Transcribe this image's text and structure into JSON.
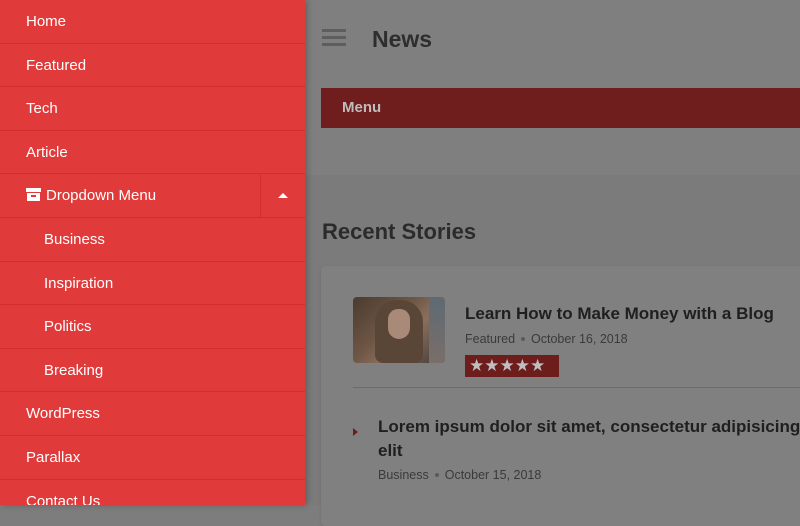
{
  "header": {
    "site_title": "News",
    "menu_label": "Menu",
    "hamburger_icon": "hamburger-menu-icon"
  },
  "content": {
    "section_title": "Recent Stories",
    "stories": [
      {
        "title": "Learn How to Make Money with a Blog",
        "category": "Featured",
        "date": "October 16, 2018",
        "rating_stars": "★★★★★",
        "rating": 5
      },
      {
        "title": "Lorem ipsum dolor sit amet, consectetur adipisicing elit",
        "category": "Business",
        "date": "October 15, 2018"
      }
    ]
  },
  "drawer": {
    "items": [
      {
        "label": "Home"
      },
      {
        "label": "Featured"
      },
      {
        "label": "Tech"
      },
      {
        "label": "Article"
      },
      {
        "label": "Dropdown Menu",
        "icon": "archive-box-icon",
        "expanded": true
      },
      {
        "label": "Business"
      },
      {
        "label": "Inspiration"
      },
      {
        "label": "Politics"
      },
      {
        "label": "Breaking"
      },
      {
        "label": "WordPress"
      },
      {
        "label": "Parallax"
      },
      {
        "label": "Contact Us"
      }
    ]
  },
  "colors": {
    "drawer_bg": "#e03a3a",
    "accent_dark": "#6e1d1d",
    "overlay_gray": "#7d7d7d"
  }
}
